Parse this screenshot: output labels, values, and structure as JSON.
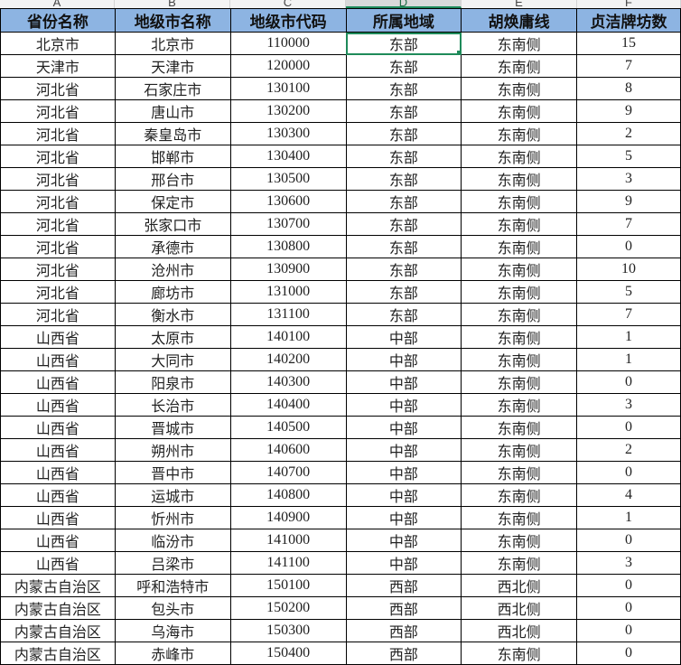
{
  "column_letters": [
    "A",
    "B",
    "C",
    "D",
    "E",
    "F"
  ],
  "active_column": "D",
  "active_cell": "D2",
  "headers": [
    "省份名称",
    "地级市名称",
    "地级市代码",
    "所属地域",
    "胡焕庸线",
    "贞洁牌坊数"
  ],
  "rows": [
    [
      "北京市",
      "北京市",
      "110000",
      "东部",
      "东南侧",
      "15"
    ],
    [
      "天津市",
      "天津市",
      "120000",
      "东部",
      "东南侧",
      "7"
    ],
    [
      "河北省",
      "石家庄市",
      "130100",
      "东部",
      "东南侧",
      "8"
    ],
    [
      "河北省",
      "唐山市",
      "130200",
      "东部",
      "东南侧",
      "9"
    ],
    [
      "河北省",
      "秦皇岛市",
      "130300",
      "东部",
      "东南侧",
      "2"
    ],
    [
      "河北省",
      "邯郸市",
      "130400",
      "东部",
      "东南侧",
      "5"
    ],
    [
      "河北省",
      "邢台市",
      "130500",
      "东部",
      "东南侧",
      "3"
    ],
    [
      "河北省",
      "保定市",
      "130600",
      "东部",
      "东南侧",
      "9"
    ],
    [
      "河北省",
      "张家口市",
      "130700",
      "东部",
      "东南侧",
      "7"
    ],
    [
      "河北省",
      "承德市",
      "130800",
      "东部",
      "东南侧",
      "0"
    ],
    [
      "河北省",
      "沧州市",
      "130900",
      "东部",
      "东南侧",
      "10"
    ],
    [
      "河北省",
      "廊坊市",
      "131000",
      "东部",
      "东南侧",
      "5"
    ],
    [
      "河北省",
      "衡水市",
      "131100",
      "东部",
      "东南侧",
      "7"
    ],
    [
      "山西省",
      "太原市",
      "140100",
      "中部",
      "东南侧",
      "1"
    ],
    [
      "山西省",
      "大同市",
      "140200",
      "中部",
      "东南侧",
      "1"
    ],
    [
      "山西省",
      "阳泉市",
      "140300",
      "中部",
      "东南侧",
      "0"
    ],
    [
      "山西省",
      "长治市",
      "140400",
      "中部",
      "东南侧",
      "3"
    ],
    [
      "山西省",
      "晋城市",
      "140500",
      "中部",
      "东南侧",
      "0"
    ],
    [
      "山西省",
      "朔州市",
      "140600",
      "中部",
      "东南侧",
      "2"
    ],
    [
      "山西省",
      "晋中市",
      "140700",
      "中部",
      "东南侧",
      "0"
    ],
    [
      "山西省",
      "运城市",
      "140800",
      "中部",
      "东南侧",
      "4"
    ],
    [
      "山西省",
      "忻州市",
      "140900",
      "中部",
      "东南侧",
      "1"
    ],
    [
      "山西省",
      "临汾市",
      "141000",
      "中部",
      "东南侧",
      "0"
    ],
    [
      "山西省",
      "吕梁市",
      "141100",
      "中部",
      "东南侧",
      "3"
    ],
    [
      "内蒙古自治区",
      "呼和浩特市",
      "150100",
      "西部",
      "西北侧",
      "0"
    ],
    [
      "内蒙古自治区",
      "包头市",
      "150200",
      "西部",
      "西北侧",
      "0"
    ],
    [
      "内蒙古自治区",
      "乌海市",
      "150300",
      "西部",
      "西北侧",
      "0"
    ],
    [
      "内蒙古自治区",
      "赤峰市",
      "150400",
      "西部",
      "东南侧",
      "0"
    ]
  ],
  "colors": {
    "header_fill": "#8db4e2",
    "selection": "#1e8a5a"
  }
}
